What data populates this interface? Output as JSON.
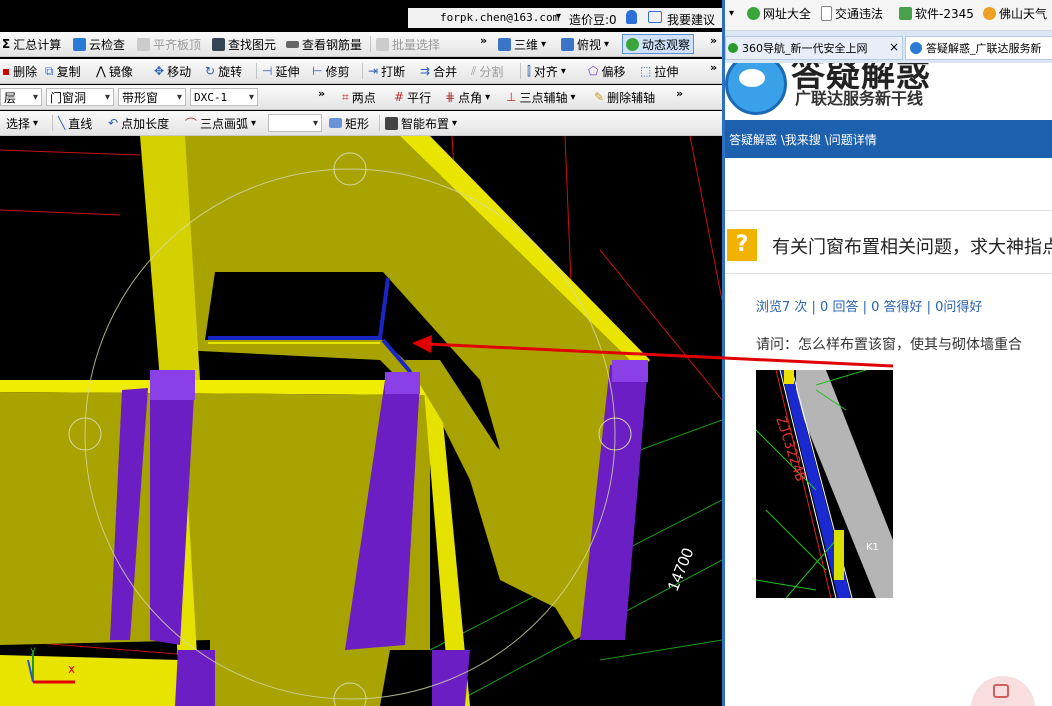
{
  "user_bar": {
    "email": "forpk.chen@163.com",
    "beans": "造价豆:0",
    "suggest": "我要建议"
  },
  "toolbar1": {
    "items": [
      "汇总计算",
      "云检查",
      "平齐板顶",
      "查找图元",
      "查看钢筋量",
      "批量选择",
      "三维",
      "俯视",
      "动态观察"
    ],
    "sum_prefix": "Σ"
  },
  "toolbar2": {
    "items": [
      "删除",
      "复制",
      "镜像",
      "移动",
      "旋转",
      "延伸",
      "修剪",
      "打断",
      "合并",
      "分割",
      "对齐",
      "偏移",
      "拉伸"
    ]
  },
  "toolbar3": {
    "layer": "层",
    "type": "门窗洞",
    "window": "带形窗",
    "code": "DXC-1",
    "axis_items": [
      "两点",
      "平行",
      "点角",
      "三点辅轴",
      "删除辅轴"
    ]
  },
  "toolbar4": {
    "items": [
      "选择",
      "直线",
      "点加长度",
      "三点画弧",
      "矩形",
      "智能布置"
    ]
  },
  "viewport": {
    "dimension": "14700",
    "axis_x": "x",
    "axis_y": "y"
  },
  "browser": {
    "bookmarks": [
      "网址大全",
      "交通违法",
      "软件-2345",
      "佛山天气"
    ],
    "tabs": [
      "360导航_新一代安全上网",
      "答疑解惑_广联达服务新"
    ],
    "logo_title": "答疑解惑",
    "logo_sub": "广联达服务新干线",
    "nav": "答疑解惑 \\我来搜 \\问题详情",
    "question_title": "有关门窗布置相关问题，求大神指点",
    "stats": "浏览7 次 | 0 回答 | 0 答得好 | 0问得好",
    "body": "请问：怎么样布置该窗，使其与砌体墙重合",
    "img_label": "ZJC3224B",
    "img_label2": "K1"
  },
  "colors": {
    "wall": "#b8b000",
    "column": "#6a1ec4",
    "accent_blue": "#1f5fa8",
    "arrow": "#e00000"
  }
}
